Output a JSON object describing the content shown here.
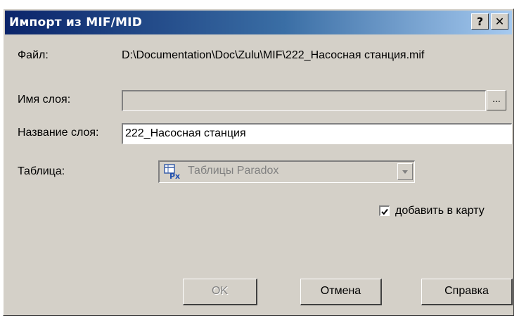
{
  "dialog": {
    "title": "Импорт из MIF/MID",
    "help_glyph": "?",
    "close_glyph": "✕"
  },
  "file": {
    "label": "Файл:",
    "value": "D:\\Documentation\\Doc\\Zulu\\MIF\\222_Насосная станция.mif"
  },
  "layer_name": {
    "label": "Имя слоя:",
    "value": "",
    "browse_label": "..."
  },
  "layer_title": {
    "label": "Название слоя:",
    "value": "222_Насосная станция"
  },
  "table": {
    "label": "Таблица:",
    "selected": "Таблицы Paradox",
    "icon": "paradox-table-icon"
  },
  "add_to_map": {
    "label": "добавить в карту",
    "checked": true
  },
  "buttons": {
    "ok": "OK",
    "cancel": "Отмена",
    "help": "Справка"
  },
  "colors": {
    "title_start": "#0a246a",
    "title_end": "#a6caf0",
    "dialog_bg": "#d4d0c8"
  }
}
